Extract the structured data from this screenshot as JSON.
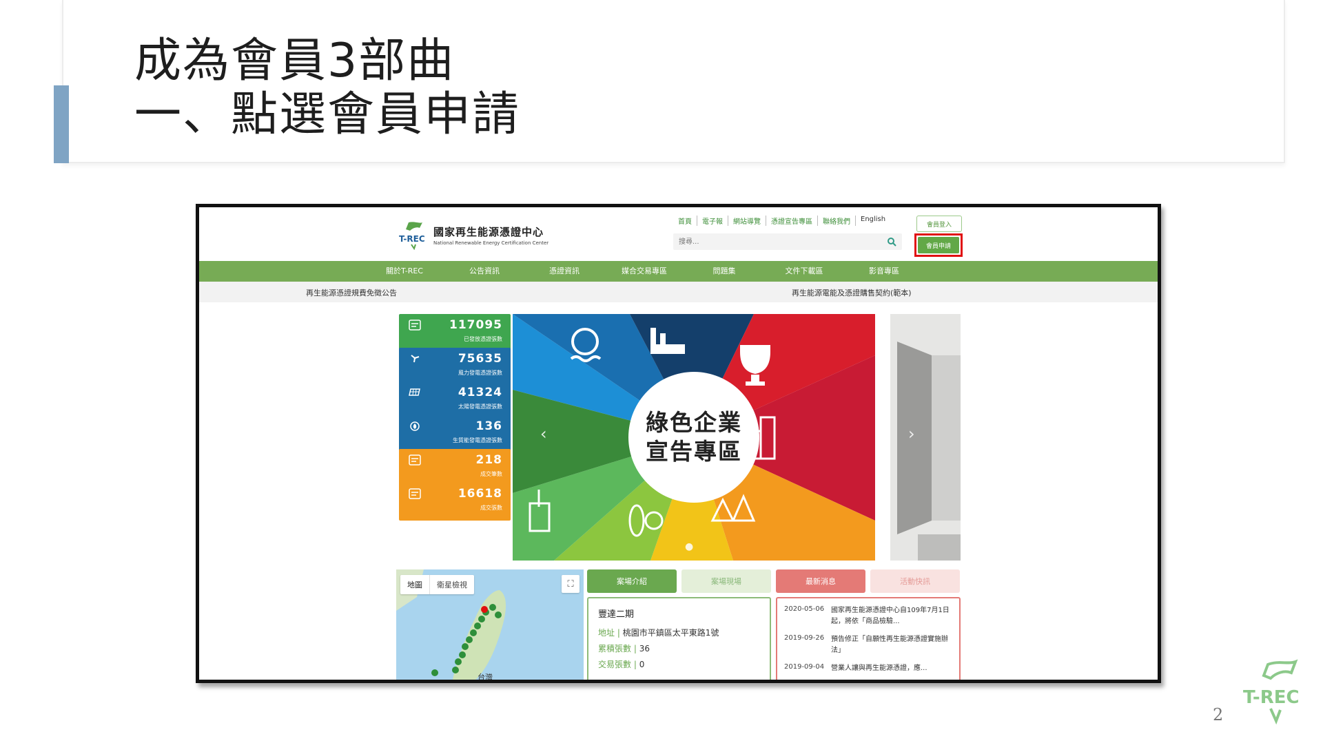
{
  "slide": {
    "title_line1": "成為會員3部曲",
    "title_line2": "一、點選會員申請",
    "page_number": "2",
    "accent_color": "#7fa4c4"
  },
  "site": {
    "logo_mark": "T-REC",
    "logo_cn": "國家再生能源憑證中心",
    "logo_en": "National Renewable Energy Certification Center",
    "top_links": [
      "首頁",
      "電子報",
      "網站導覽",
      "憑證宣告專區",
      "聯絡我們",
      "English"
    ],
    "search_placeholder": "搜尋...",
    "login_label": "會員登入",
    "apply_label": "會員申請",
    "nav": [
      "關於T-REC",
      "公告資訊",
      "憑證資訊",
      "媒合交易專區",
      "問題集",
      "文件下載區",
      "影音專區"
    ],
    "notice_left": "再生能源憑證規費免徵公告",
    "notice_right": "再生能源電能及憑證購售契約(範本)",
    "stats": [
      {
        "value": "117095",
        "label": "已發放憑證張數",
        "icon": "certificate-icon",
        "color": "green"
      },
      {
        "value": "75635",
        "label": "風力發電憑證張數",
        "icon": "wind-turbine-icon",
        "color": "blue"
      },
      {
        "value": "41324",
        "label": "太陽發電憑證張數",
        "icon": "solar-panel-icon",
        "color": "blue"
      },
      {
        "value": "136",
        "label": "生質能發電憑證張數",
        "icon": "biomass-icon",
        "color": "blue"
      },
      {
        "value": "218",
        "label": "成交筆數",
        "icon": "document-icon",
        "color": "orange"
      },
      {
        "value": "16618",
        "label": "成交張數",
        "icon": "document-icon",
        "color": "orange"
      }
    ],
    "banner_line1": "綠色企業",
    "banner_line2": "宣告專區",
    "map_tabs": [
      "地圖",
      "衛星檢視"
    ],
    "map_label": "台灣",
    "tabs": [
      "案場介紹",
      "案場現場",
      "最新消息",
      "活動快訊"
    ],
    "site_card": {
      "name": "豐達二期",
      "address_key": "地址 | ",
      "address": "桃園市平鎮區太平東路1號",
      "total_key": "累積張數 | ",
      "total": "36",
      "trade_key": "交易張數 | ",
      "trade": "0"
    },
    "news": [
      {
        "date": "2020-05-06",
        "text": "國家再生能源憑證中心自109年7月1日起，將依「商品檢驗..."
      },
      {
        "date": "2019-09-26",
        "text": "預告修正「自願性再生能源憑證實施辦法」"
      },
      {
        "date": "2019-09-04",
        "text": "營業人讓與再生能源憑證，應..."
      }
    ],
    "colors": {
      "nav_green": "#77ab55",
      "highlight_red": "#e01010",
      "stat_blue": "#1e6ea6",
      "stat_orange": "#f39a1e"
    }
  }
}
